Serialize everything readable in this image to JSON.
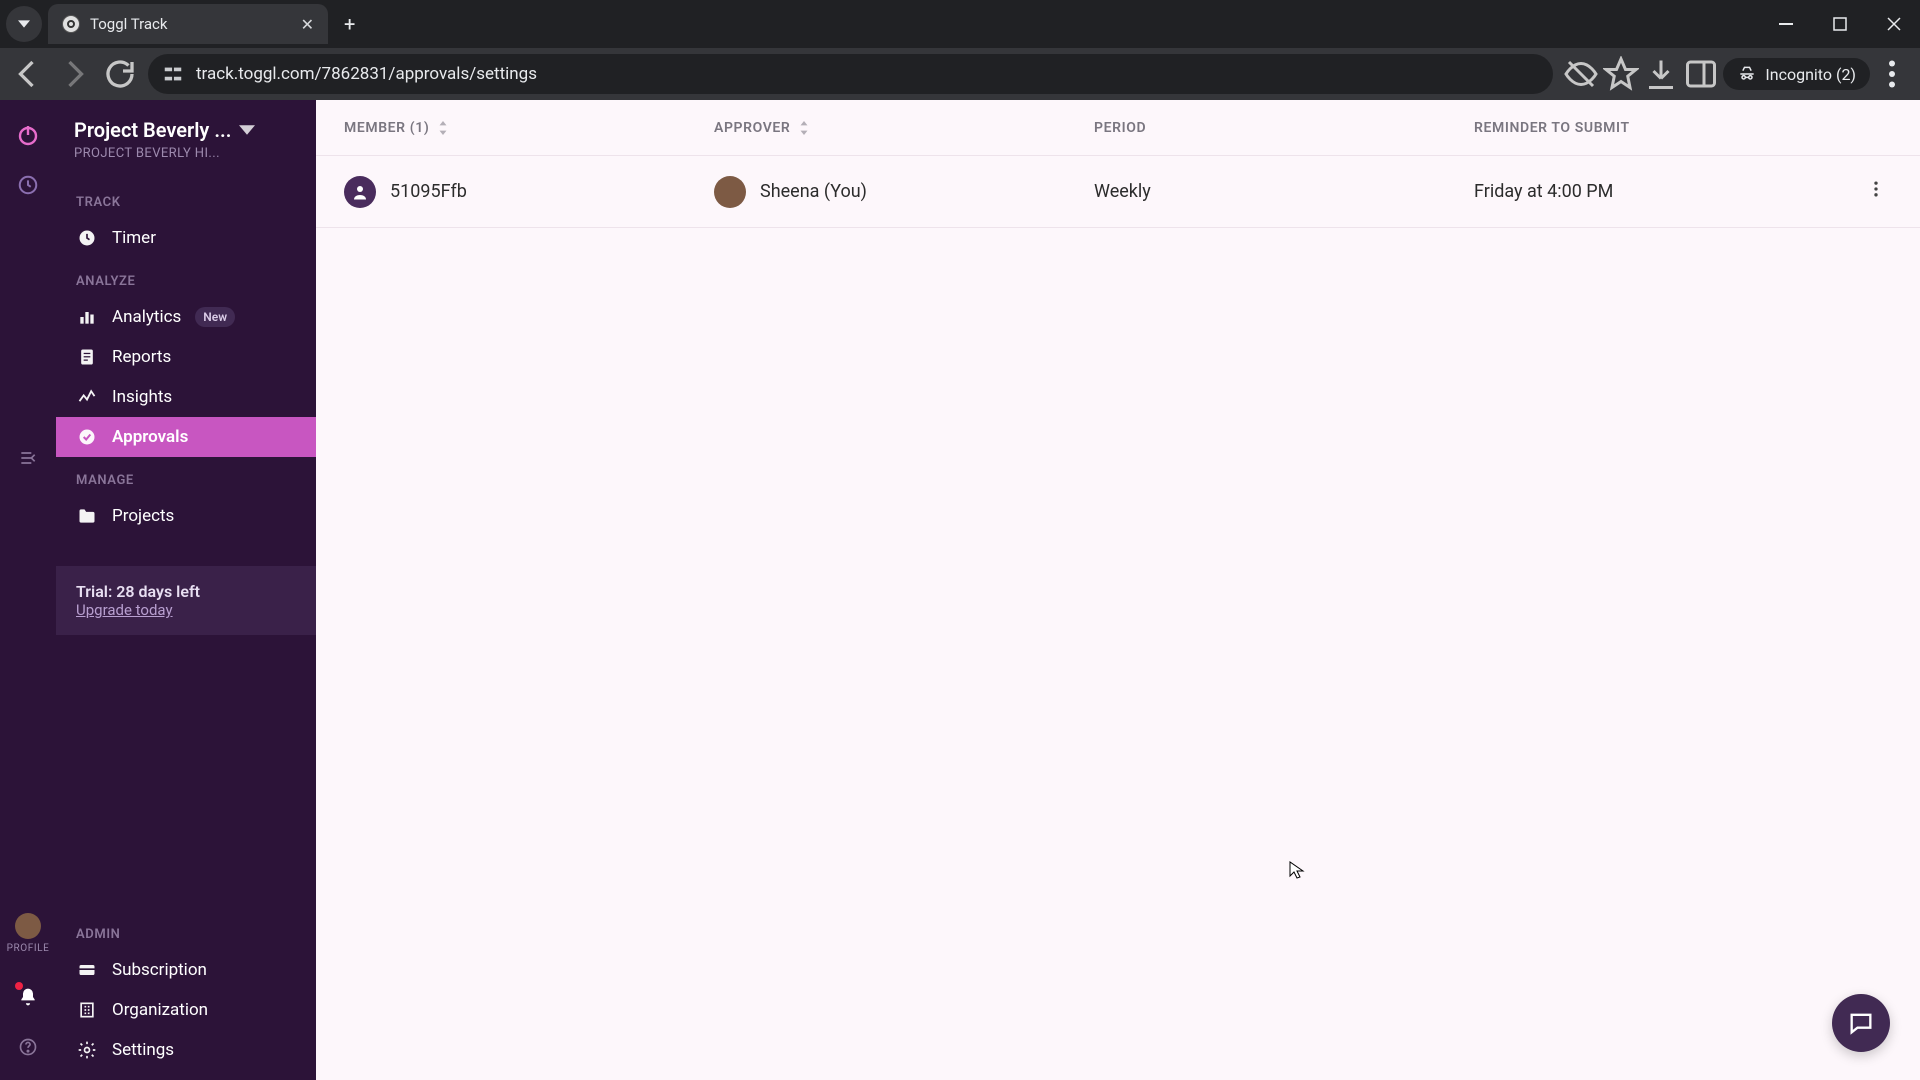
{
  "browser": {
    "tab_title": "Toggl Track",
    "url": "track.toggl.com/7862831/approvals/settings",
    "incognito_label": "Incognito (2)"
  },
  "rail": {
    "profile_label": "PROFILE"
  },
  "sidebar": {
    "workspace_name": "Project Beverly ...",
    "workspace_sub": "PROJECT BEVERLY HI...",
    "sections": {
      "track": "TRACK",
      "analyze": "ANALYZE",
      "manage": "MANAGE",
      "admin": "ADMIN"
    },
    "items": {
      "timer": "Timer",
      "analytics": "Analytics",
      "analytics_badge": "New",
      "reports": "Reports",
      "insights": "Insights",
      "approvals": "Approvals",
      "projects": "Projects",
      "subscription": "Subscription",
      "organization": "Organization",
      "settings": "Settings"
    },
    "trial": {
      "title": "Trial: 28 days left",
      "link": "Upgrade today"
    }
  },
  "table": {
    "headers": {
      "member": "MEMBER (1)",
      "approver": "APPROVER",
      "period": "PERIOD",
      "reminder": "REMINDER TO SUBMIT"
    },
    "rows": [
      {
        "member": "51095Ffb",
        "approver": "Sheena (You)",
        "period": "Weekly",
        "reminder": "Friday at 4:00 PM"
      }
    ]
  }
}
